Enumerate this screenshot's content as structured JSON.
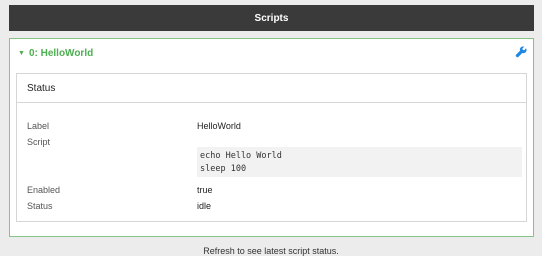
{
  "header": {
    "title": "Scripts"
  },
  "panel": {
    "title": "0: HelloWorld",
    "caret_icon": "caret-down-icon",
    "action_icon": "wrench-icon",
    "accent_color": "#4caf50"
  },
  "status_section": {
    "heading": "Status",
    "label_key": "Label",
    "label_value": "HelloWorld",
    "script_key": "Script",
    "script_lines": [
      "echo Hello World",
      "sleep 100"
    ],
    "enabled_key": "Enabled",
    "enabled_value": "true",
    "status_key": "Status",
    "status_value": "idle"
  },
  "footer": {
    "text": "Refresh to see latest script status."
  }
}
